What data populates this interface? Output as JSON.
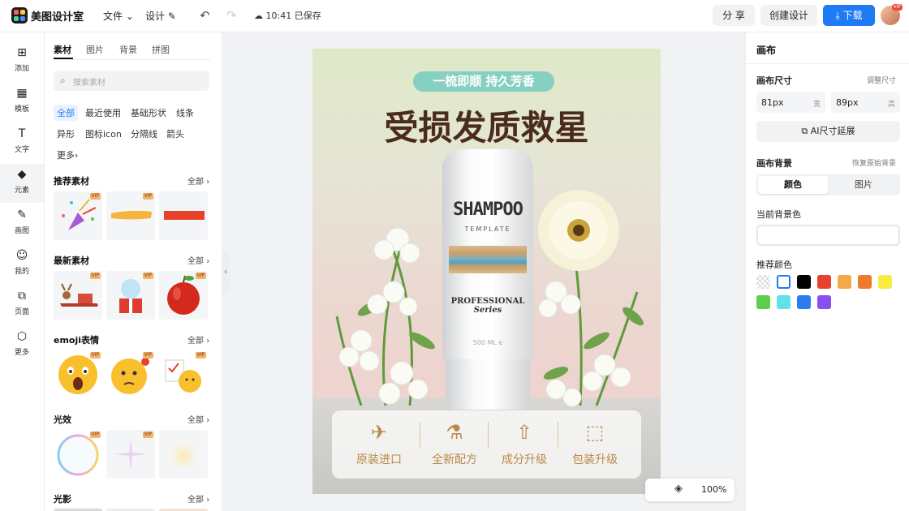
{
  "app": {
    "title": "美图设计室"
  },
  "topbar": {
    "menu_file": "文件",
    "menu_design": "设计",
    "save_status": "10:41 已保存",
    "share_label": "分 享",
    "create_label": "创建设计",
    "download_label": "下载",
    "avatar_badge": "VIP"
  },
  "rail": {
    "items": [
      {
        "label": "添加",
        "icon": "plus-square-icon"
      },
      {
        "label": "模板",
        "icon": "template-icon"
      },
      {
        "label": "文字",
        "icon": "text-icon"
      },
      {
        "label": "元素",
        "icon": "element-icon"
      },
      {
        "label": "画图",
        "icon": "draw-icon"
      },
      {
        "label": "我的",
        "icon": "user-icon"
      },
      {
        "label": "页面",
        "icon": "page-icon"
      },
      {
        "label": "更多",
        "icon": "cube-icon"
      }
    ],
    "active_index": 3
  },
  "panel": {
    "tabs": [
      "素材",
      "图片",
      "背景",
      "拼图"
    ],
    "search_placeholder": "搜索素材",
    "chips": [
      "全部",
      "最近使用",
      "基础形状",
      "线条",
      "异形",
      "图标icon",
      "分隔线",
      "箭头",
      "更多"
    ],
    "sections": [
      {
        "title": "推荐素材",
        "all": "全部"
      },
      {
        "title": "最新素材",
        "all": "全部"
      },
      {
        "title": "emoji表情",
        "all": "全部"
      },
      {
        "title": "光效",
        "all": "全部"
      },
      {
        "title": "光影",
        "all": "全部"
      }
    ],
    "vip_badge": "VIP"
  },
  "poster": {
    "tag": "一梳即顺 持久芳香",
    "headline": "受损发质救星",
    "bottle_brand": "SHAMPOO",
    "bottle_sub": "TEMPLATE",
    "bottle_prof": "PROFESSIONAL",
    "bottle_series": "Series",
    "bottle_volume": "500 ML e",
    "features": [
      "原装进口",
      "全新配方",
      "成分升级",
      "包装升级"
    ]
  },
  "zoom": {
    "value": "100%"
  },
  "rpanel": {
    "title": "画布",
    "size_label": "画布尺寸",
    "size_link": "调整尺寸",
    "width_value": "81px",
    "width_unit": "宽",
    "height_value": "89px",
    "height_unit": "高",
    "ai_button": "AI尺寸延展",
    "bg_label": "画布背景",
    "bg_link": "恢复原始背景",
    "seg_color": "颜色",
    "seg_image": "图片",
    "current_bg_label": "当前背景色",
    "recommended_label": "推荐颜色",
    "colors": [
      "transparent",
      "#ffffff",
      "#000000",
      "#e8412c",
      "#f3a94a",
      "#ef7a2c",
      "#f7ec3f",
      "#5ccf4e",
      "#5ee3ea",
      "#2a7df0",
      "#8a4ff0"
    ]
  }
}
